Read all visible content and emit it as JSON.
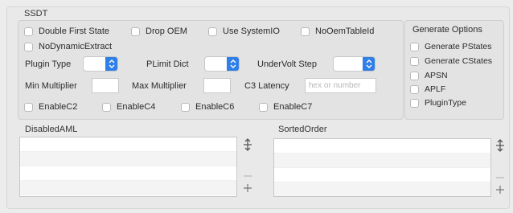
{
  "ssdt": {
    "title": "SSDT",
    "checkboxes_row1": [
      "Double First State",
      "Drop OEM",
      "Use SystemIO",
      "NoOemTableId"
    ],
    "checkbox_nodynamic": "NoDynamicExtract",
    "plugin_type_label": "Plugin Type",
    "plimit_dict_label": "PLimit Dict",
    "undervolt_step_label": "UnderVolt Step",
    "min_multiplier_label": "Min Multiplier",
    "max_multiplier_label": "Max Multiplier",
    "c3_latency_label": "C3 Latency",
    "c3_latency_placeholder": "hex or number",
    "enable_checkboxes": [
      "EnableC2",
      "EnableC4",
      "EnableC6",
      "EnableC7"
    ]
  },
  "generate_options": {
    "title": "Generate Options",
    "items": [
      "Generate PStates",
      "Generate CStates",
      "APSN",
      "APLF",
      "PluginType"
    ]
  },
  "disabled_aml": {
    "title": "DisabledAML"
  },
  "sorted_order": {
    "title": "SortedOrder"
  },
  "icons": {
    "move": "move-arrows-icon",
    "remove": "minus-icon",
    "add": "plus-icon",
    "popup_arrow": "chevron-updown-icon"
  },
  "colors": {
    "accent": "#2f7fe6"
  }
}
